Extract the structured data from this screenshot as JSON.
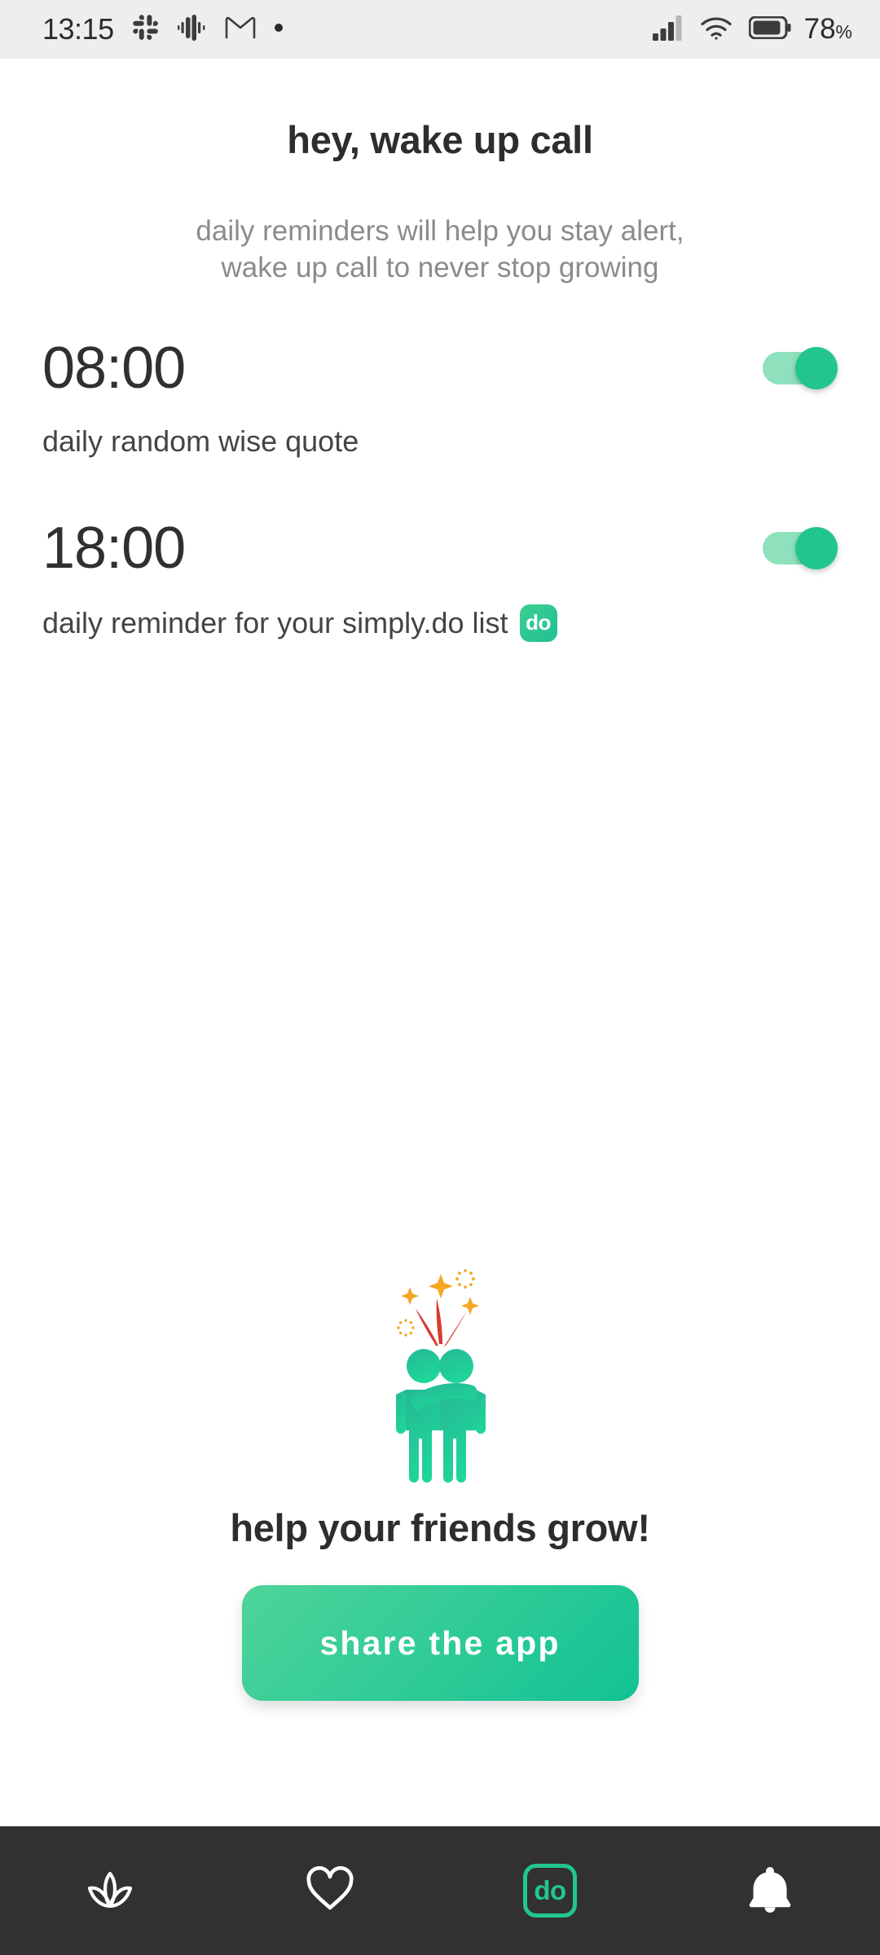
{
  "status_bar": {
    "time": "13:15",
    "left_icons": [
      "slack-icon",
      "audio-wave-icon",
      "gmail-icon",
      "dot-indicator-icon"
    ],
    "right_icons": [
      "cellular-signal-icon",
      "wifi-icon",
      "battery-icon"
    ],
    "battery_percent": "78",
    "percent_sign": "%",
    "background_color": "#eeeeee"
  },
  "header": {
    "title": "hey, wake up call",
    "subtitle_line1": "daily reminders will help you stay alert,",
    "subtitle_line2": "wake up call to never stop growing"
  },
  "reminders": [
    {
      "time": "08:00",
      "description": "daily random wise quote",
      "has_do_badge": false,
      "badge_label": "",
      "toggle_on": true
    },
    {
      "time": "18:00",
      "description": "daily reminder for your simply.do list",
      "has_do_badge": true,
      "badge_label": "do",
      "toggle_on": true
    }
  ],
  "promo": {
    "illustration": "two-friends-celebrating-icon",
    "caption": "help your friends grow!",
    "share_button_label": "share the app"
  },
  "bottom_nav": {
    "items": [
      {
        "name": "lotus",
        "icon": "lotus-icon",
        "label": "",
        "active": false
      },
      {
        "name": "favorites",
        "icon": "heart-icon",
        "label": "",
        "active": false
      },
      {
        "name": "do-list",
        "icon": "do-badge-icon",
        "label": "do",
        "active": false
      },
      {
        "name": "reminders",
        "icon": "bell-icon",
        "label": "",
        "active": true
      }
    ],
    "background_color": "#313131"
  },
  "colors": {
    "accent_green": "#22c68c",
    "accent_green_light": "#8fe0bd",
    "accent_gradient_start": "#4ed49a",
    "accent_gradient_end": "#12c294",
    "sparkle_orange": "#f5a623",
    "streamer_red": "#d83a2e",
    "text_primary": "#2d2d2d",
    "text_secondary": "#8b8b8b"
  }
}
